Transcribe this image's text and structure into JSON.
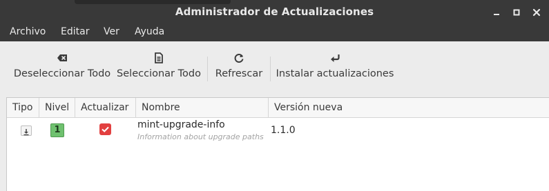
{
  "window": {
    "title": "Administrador de Actualizaciones"
  },
  "menu": {
    "items": [
      "Archivo",
      "Editar",
      "Ver",
      "Ayuda"
    ]
  },
  "toolbar": {
    "buttons": [
      {
        "label": "Deseleccionar Todo",
        "icon": "backspace-icon"
      },
      {
        "label": "Seleccionar Todo",
        "icon": "document-icon"
      },
      {
        "label": "Refrescar",
        "icon": "refresh-icon"
      },
      {
        "label": "Instalar actualizaciones",
        "icon": "return-arrow-icon"
      }
    ]
  },
  "table": {
    "columns": [
      "Tipo",
      "Nivel",
      "Actualizar",
      "Nombre",
      "Versión nueva"
    ],
    "rows": [
      {
        "type_icon": "package-download-icon",
        "level": "1",
        "update": true,
        "name": "mint-upgrade-info",
        "description": "Information about upgrade paths",
        "new_version": "1.1.0"
      }
    ]
  },
  "colors": {
    "titlebar": "#393939",
    "level_badge": "#6fc16f",
    "checkbox_checked": "#e24040"
  }
}
